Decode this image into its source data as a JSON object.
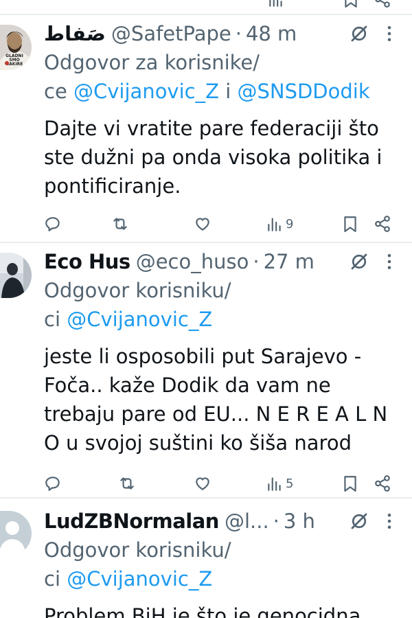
{
  "tweets": [
    {
      "name": "صَفاط",
      "handle": "@SafetPape",
      "time": "48 m",
      "reply_label": "Odgovor za korisnike/",
      "reply_prefix": "ce",
      "mention_1": "@Cvijanovic_Z",
      "reply_join": "i",
      "mention_2": "@SNSDDodik",
      "text_lines": [
        "Dajte vi vratite pare federaciji što",
        "ste dužni pa onda visoka politika i",
        "pontificiranje."
      ],
      "views": "9",
      "avatar_text": [
        "GLADNI",
        "SMO",
        "BAKIRE"
      ]
    },
    {
      "name": "Eco Hus",
      "handle": "@eco_huso",
      "time": "27 m",
      "reply_label": "Odgovor korisniku/",
      "reply_prefix": "ci",
      "mention_1": "@Cvijanovic_Z",
      "text_lines": [
        "jeste li osposobili put Sarajevo -",
        "Foča.. kaže Dodik da vam ne",
        "trebaju pare od EU... N E R E A L N",
        "O u svojoj suštini ko šiša narod"
      ],
      "views": "5"
    },
    {
      "name": "LudZBNormalan",
      "handle": "@l...",
      "time": "3 h",
      "reply_label": "Odgovor korisniku/",
      "reply_prefix": "ci",
      "mention_1": "@Cvijanovic_Z",
      "text_lines": [
        "Problem BiH je što je genocidna"
      ]
    }
  ],
  "colors": {
    "secondary_text": "#536471",
    "mention": "#1d9bf0",
    "divider": "#e9edf0"
  },
  "icons": [
    "reply-icon",
    "retweet-icon",
    "like-icon",
    "views-icon",
    "bookmark-icon",
    "share-icon",
    "grok-icon",
    "more-icon"
  ]
}
